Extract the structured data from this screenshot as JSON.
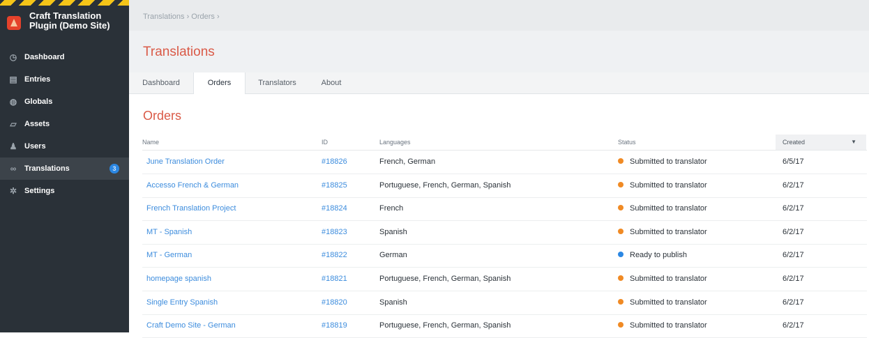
{
  "site": {
    "name": "Craft Translation Plugin (Demo Site)",
    "logo_icon": "craft-logo-icon"
  },
  "nav": [
    {
      "label": "Dashboard",
      "icon": "◷",
      "icon_name": "dashboard-icon"
    },
    {
      "label": "Entries",
      "icon": "▤",
      "icon_name": "entries-icon"
    },
    {
      "label": "Globals",
      "icon": "◍",
      "icon_name": "globe-icon"
    },
    {
      "label": "Assets",
      "icon": "▱",
      "icon_name": "assets-icon"
    },
    {
      "label": "Users",
      "icon": "♟",
      "icon_name": "users-icon"
    },
    {
      "label": "Translations",
      "icon": "∞",
      "icon_name": "translations-icon",
      "selected": true,
      "badge": "3"
    },
    {
      "label": "Settings",
      "icon": "✲",
      "icon_name": "settings-icon"
    }
  ],
  "breadcrumb": "Translations › Orders ›",
  "page_title": "Translations",
  "tabs": [
    {
      "label": "Dashboard",
      "selected": false
    },
    {
      "label": "Orders",
      "selected": true
    },
    {
      "label": "Translators",
      "selected": false
    },
    {
      "label": "About",
      "selected": false
    }
  ],
  "section_title": "Orders",
  "columns": [
    "Name",
    "ID",
    "Languages",
    "Status",
    "Created"
  ],
  "status_colors": {
    "Submitted to translator": "#f08a24",
    "Ready to publish": "#2b87e3"
  },
  "orders": [
    {
      "name": "June Translation Order",
      "id": "#18826",
      "languages": "French, German",
      "status": "Submitted to translator",
      "created": "6/5/17"
    },
    {
      "name": "Accesso French & German",
      "id": "#18825",
      "languages": "Portuguese, French, German, Spanish",
      "status": "Submitted to translator",
      "created": "6/2/17"
    },
    {
      "name": "French Translation Project",
      "id": "#18824",
      "languages": "French",
      "status": "Submitted to translator",
      "created": "6/2/17"
    },
    {
      "name": "MT - Spanish",
      "id": "#18823",
      "languages": "Spanish",
      "status": "Submitted to translator",
      "created": "6/2/17"
    },
    {
      "name": "MT - German",
      "id": "#18822",
      "languages": "German",
      "status": "Ready to publish",
      "created": "6/2/17"
    },
    {
      "name": "homepage spanish",
      "id": "#18821",
      "languages": "Portuguese, French, German, Spanish",
      "status": "Submitted to translator",
      "created": "6/2/17"
    },
    {
      "name": "Single Entry Spanish",
      "id": "#18820",
      "languages": "Spanish",
      "status": "Submitted to translator",
      "created": "6/2/17"
    },
    {
      "name": "Craft Demo Site - German",
      "id": "#18819",
      "languages": "Portuguese, French, German, Spanish",
      "status": "Submitted to translator",
      "created": "6/2/17"
    }
  ]
}
